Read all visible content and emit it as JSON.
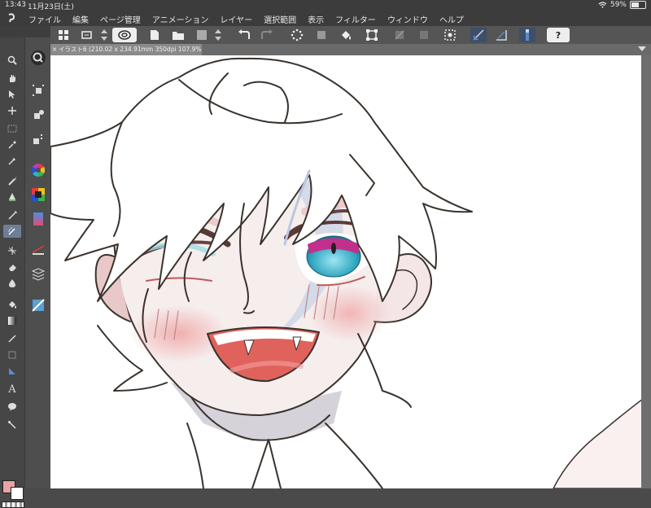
{
  "status_bar": {
    "time": "13:43",
    "date": "11月23日(土)",
    "battery": "59%",
    "battery_level": 0.59
  },
  "menu": [
    "ファイル",
    "編集",
    "ページ管理",
    "アニメーション",
    "レイヤー",
    "選択範囲",
    "表示",
    "フィルター",
    "ウィンドウ",
    "ヘルプ"
  ],
  "document_tab": {
    "close": "×",
    "title": "イラスト6 (210.02 x 234.91mm 350dpi 107.9%)"
  },
  "toolbar": {
    "help_label": "?"
  },
  "tools": {
    "text_tool_glyph": "A"
  },
  "colors": {
    "main_color": "#e8a4a4",
    "sub_color": "#ffffff",
    "ui_dark": "#3c3c3c",
    "accent": "#6d7f96"
  },
  "icons": [
    "wi-fi-icon",
    "battery-icon",
    "app-logo-icon",
    "layout-icon",
    "transform-icon",
    "spin-icon",
    "undo-icon",
    "redo-icon",
    "help-icon"
  ]
}
